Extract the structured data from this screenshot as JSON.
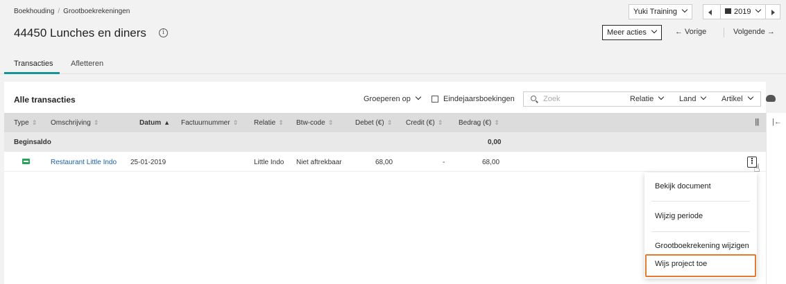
{
  "breadcrumb": {
    "root": "Boekhouding",
    "separator": "/",
    "current": "Grootboekrekeningen"
  },
  "page": {
    "title": "44450 Lunches en diners",
    "info_glyph": "i"
  },
  "header": {
    "company": "Yuki Training",
    "year": "2019",
    "more_actions": "Meer acties",
    "prev": "← Vorige",
    "next": "Volgende →"
  },
  "tabs": [
    {
      "label": "Transacties",
      "active": true
    },
    {
      "label": "Afletteren",
      "active": false
    }
  ],
  "toolbar": {
    "title": "Alle transacties",
    "group_by": "Groeperen op",
    "year_end_label": "Eindejaarsboekingen",
    "search_placeholder": "Zoek",
    "filters": [
      "Relatie",
      "Land",
      "Artikel"
    ]
  },
  "table": {
    "columns": [
      "Type",
      "Omschrijving",
      "Datum",
      "Factuurnummer",
      "Relatie",
      "Btw-code",
      "Debet (€)",
      "Credit (€)",
      "Bedrag (€)"
    ],
    "sort_glyph": "⇕",
    "sort_active_glyph": "▲",
    "begin_label": "Beginsaldo",
    "begin_amount": "0,00",
    "rows": [
      {
        "description": "Restaurant Little Indo",
        "date": "25-01-2019",
        "invoice": "",
        "relation": "Little Indo",
        "vat": "Niet aftrekbaar",
        "debit": "68,00",
        "credit": "-",
        "amount": "68,00"
      }
    ]
  },
  "menu": {
    "items": [
      "Bekijk document",
      "Wijzig periode",
      "Grootboekrekening wijzigen",
      "Wijs project toe"
    ]
  },
  "colors": {
    "accent": "#13929a",
    "highlight": "#e57a30",
    "link": "#1a5fa8",
    "doc_icon": "#27a35a"
  },
  "icons": {
    "kebab": "⋮",
    "columns": "|||",
    "pin": "|←",
    "pointer": "☝"
  }
}
